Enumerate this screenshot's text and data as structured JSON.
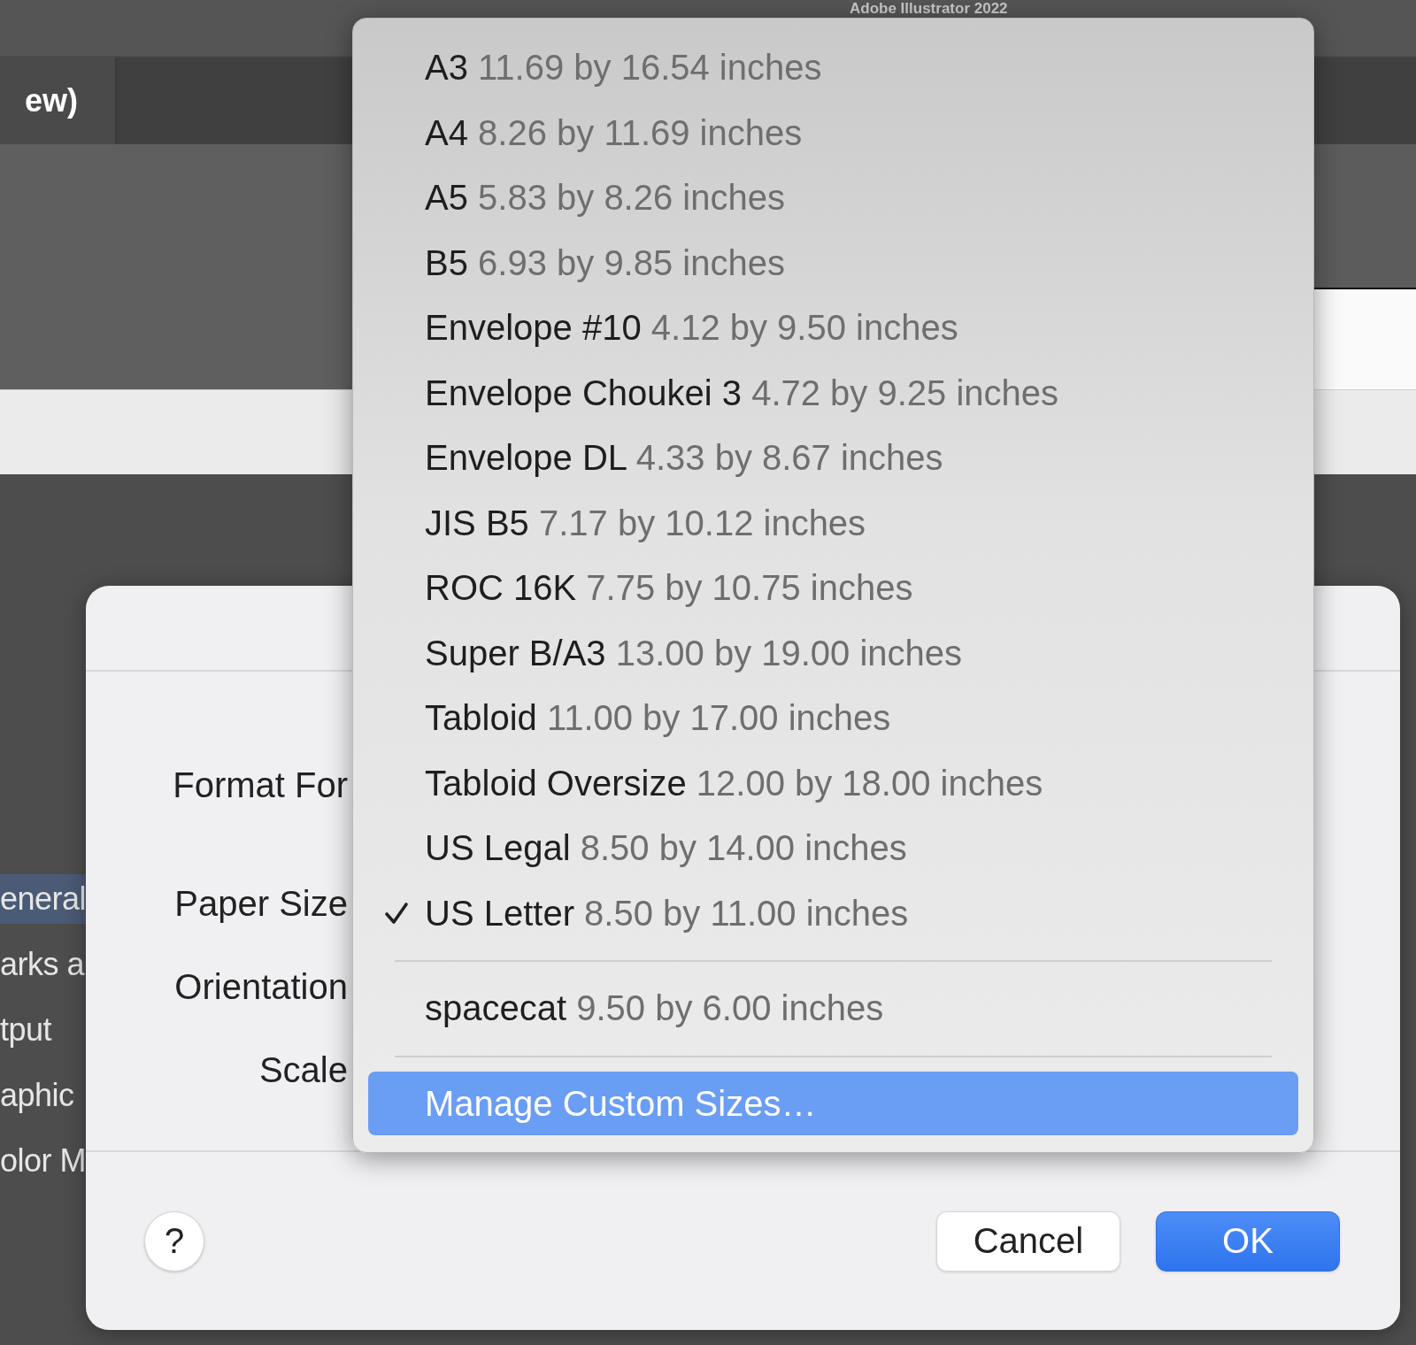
{
  "app": {
    "title": "Adobe Illustrator 2022",
    "tab": "ew)",
    "sidebar": [
      {
        "label": "eneral",
        "selected": true
      },
      {
        "label": "arks a",
        "selected": false
      },
      {
        "label": "tput",
        "selected": false
      },
      {
        "label": "aphic",
        "selected": false
      },
      {
        "label": "olor M",
        "selected": false
      }
    ]
  },
  "dialog": {
    "fields": [
      {
        "label": "Format For"
      },
      {
        "label": "Paper Size"
      },
      {
        "label": "Orientation"
      },
      {
        "label": "Scale"
      }
    ],
    "help": "?",
    "buttons": [
      {
        "label": "Cancel",
        "kind": "secondary"
      },
      {
        "label": "OK",
        "kind": "primary"
      }
    ]
  },
  "menu": {
    "groups": [
      [
        {
          "kind": "size",
          "name": "A3",
          "size": "11.69 by 16.54 inches",
          "checked": false
        },
        {
          "kind": "size",
          "name": "A4",
          "size": "8.26 by 11.69 inches",
          "checked": false
        },
        {
          "kind": "size",
          "name": "A5",
          "size": "5.83 by 8.26 inches",
          "checked": false
        },
        {
          "kind": "size",
          "name": "B5",
          "size": "6.93 by 9.85 inches",
          "checked": false
        },
        {
          "kind": "size",
          "name": "Envelope #10",
          "size": "4.12 by 9.50 inches",
          "checked": false
        },
        {
          "kind": "size",
          "name": "Envelope Choukei 3",
          "size": "4.72 by 9.25 inches",
          "checked": false
        },
        {
          "kind": "size",
          "name": "Envelope DL",
          "size": "4.33 by 8.67 inches",
          "checked": false
        },
        {
          "kind": "size",
          "name": "JIS B5",
          "size": "7.17 by 10.12 inches",
          "checked": false
        },
        {
          "kind": "size",
          "name": "ROC 16K",
          "size": "7.75 by 10.75 inches",
          "checked": false
        },
        {
          "kind": "size",
          "name": "Super B/A3",
          "size": "13.00 by 19.00 inches",
          "checked": false
        },
        {
          "kind": "size",
          "name": "Tabloid",
          "size": "11.00 by 17.00 inches",
          "checked": false
        },
        {
          "kind": "size",
          "name": "Tabloid Oversize",
          "size": "12.00 by 18.00 inches",
          "checked": false
        },
        {
          "kind": "size",
          "name": "US Legal",
          "size": "8.50 by 14.00 inches",
          "checked": false
        },
        {
          "kind": "size",
          "name": "US Letter",
          "size": "8.50 by 11.00 inches",
          "checked": true
        }
      ],
      [
        {
          "kind": "size",
          "name": "spacecat",
          "size": "9.50 by 6.00 inches",
          "checked": false
        }
      ],
      [
        {
          "kind": "action",
          "name": "Manage Custom Sizes…",
          "highlighted": true
        }
      ]
    ]
  }
}
